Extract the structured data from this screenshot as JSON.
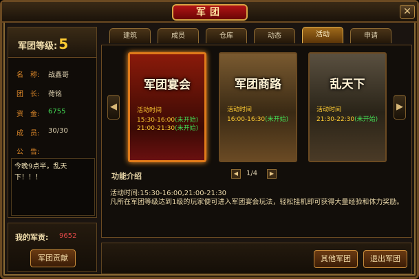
{
  "window": {
    "title": "军团",
    "close_label": "✕"
  },
  "legion": {
    "level_label": "军团等级:",
    "level_value": "5",
    "fields": [
      {
        "key": "名　称:",
        "value": "战鑫哥"
      },
      {
        "key": "团　长:",
        "value": "荷铭"
      },
      {
        "key": "资　金:",
        "value": "6755"
      },
      {
        "key": "成　员:",
        "value": "30/30"
      }
    ],
    "notice_label": "公　告:",
    "notice_text": "今晚9点半，乱天下！！！"
  },
  "contribution": {
    "label": "我的军贡:",
    "value": "9652",
    "button": "军团贡献"
  },
  "tabs": [
    "建筑",
    "成员",
    "仓库",
    "动态",
    "活动",
    "申请"
  ],
  "active_tab": "活动",
  "activities": [
    {
      "title": "军团宴会",
      "time_label": "活动时间",
      "slot1": "15:30-16:00",
      "status1": "(未开始)",
      "slot2": "21:00-21:30",
      "status2": "(未开始)"
    },
    {
      "title": "军团商路",
      "time_label": "活动时间",
      "slot1": "16:00-16:30",
      "status1": "(未开始)"
    },
    {
      "title": "乱天下",
      "time_label": "活动时间",
      "slot1": "21:30-22:30",
      "status1": "(未开始)"
    }
  ],
  "feature": {
    "label": "功能介绍",
    "page": "1/4",
    "time_text": "活动时间:15:30-16:00,21:00-21:30",
    "description": "凡所在军团等级达到1级的玩家便可进入军团宴会玩法，轻松挂机即可获得大量经验和体力奖励。"
  },
  "buttons": {
    "other": "其他军团",
    "exit": "退出军团"
  },
  "icons": {
    "arrow_left": "◀",
    "arrow_right": "▶",
    "page_prev": "◀",
    "page_next": "▶"
  }
}
